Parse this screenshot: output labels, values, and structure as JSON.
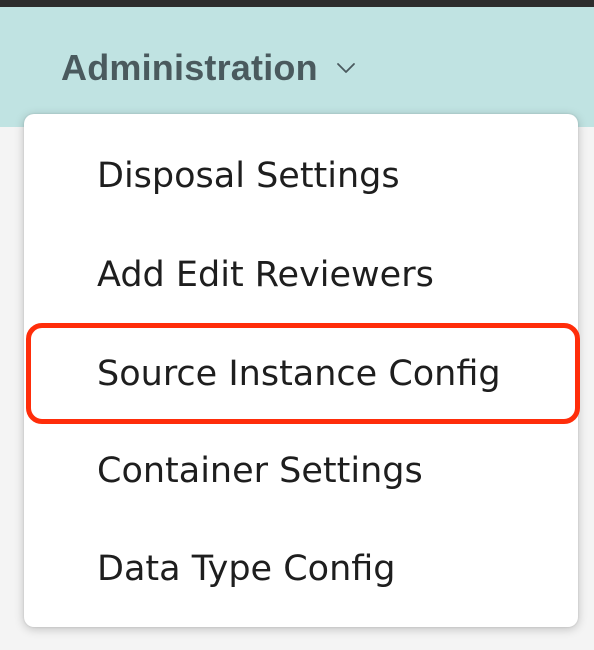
{
  "nav": {
    "menu_label": "Administration",
    "chevron_icon": "chevron-down-icon"
  },
  "dropdown": {
    "items": [
      {
        "label": "Disposal Settings"
      },
      {
        "label": "Add Edit Reviewers"
      },
      {
        "label": "Source Instance Config"
      },
      {
        "label": "Container Settings"
      },
      {
        "label": "Data Type Config"
      }
    ],
    "highlighted_item": "Source Instance Config"
  },
  "colors": {
    "nav_background": "#c0e3e2",
    "nav_text": "#4a5a5e",
    "menu_text": "#1e1e1e",
    "highlight_border": "#ff2d0a",
    "top_strip": "#2d2d2d"
  }
}
